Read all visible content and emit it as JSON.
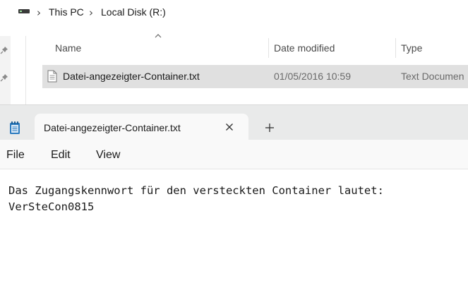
{
  "explorer": {
    "breadcrumb": [
      "This PC",
      "Local Disk (R:)"
    ],
    "columns": [
      "Name",
      "Date modified",
      "Type"
    ],
    "files": [
      {
        "name": "Datei-angezeigter-Container.txt",
        "date_modified": "01/05/2016 10:59",
        "type": "Text Documen"
      }
    ]
  },
  "notepad": {
    "tab_title": "Datei-angezeigter-Container.txt",
    "menu": [
      "File",
      "Edit",
      "View"
    ],
    "content_lines": [
      "Das Zugangskennwort für den versteckten Container lautet:",
      "VerSteCon0815"
    ]
  },
  "colors": {
    "selected_row": "#e0e0e0",
    "tabbar": "#e9eaea",
    "notepad_icon": "#2b7bbf"
  },
  "icons": [
    "drive-icon",
    "chevron-right-icon",
    "pin-icon",
    "sort-up-icon",
    "text-file-icon",
    "notepad-icon",
    "close-icon",
    "plus-icon"
  ]
}
